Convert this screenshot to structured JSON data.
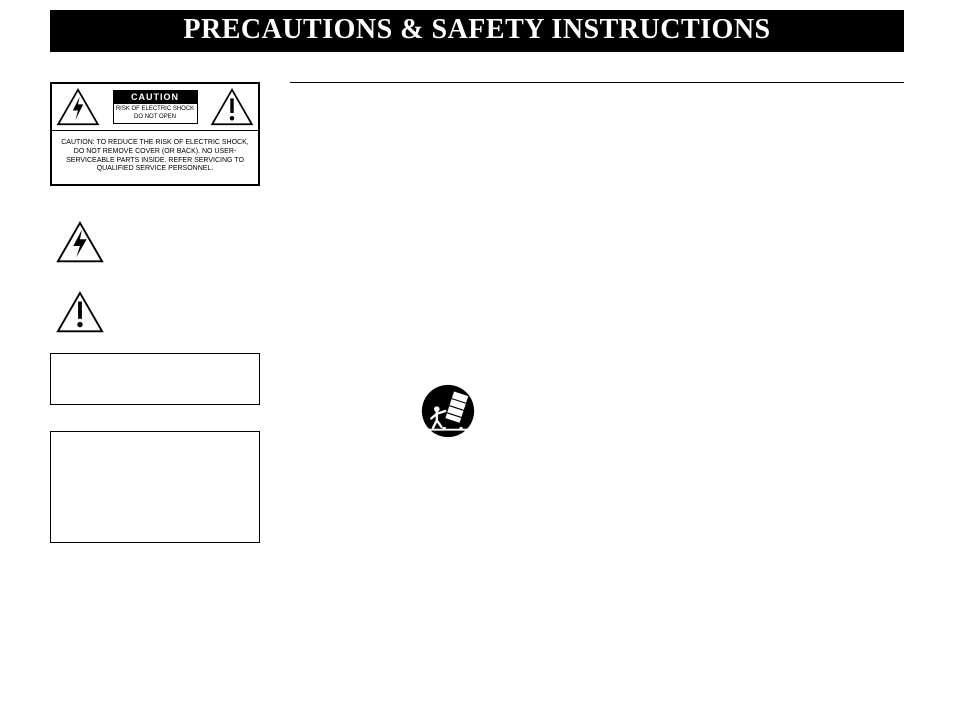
{
  "title": "PRECAUTIONS & SAFETY INSTRUCTIONS",
  "caution": {
    "header": "CAUTION",
    "sub1": "RISK OF ELECTRIC SHOCK",
    "sub2": "DO NOT OPEN",
    "body": "CAUTION:  TO REDUCE THE RISK OF ELECTRIC SHOCK, DO NOT REMOVE COVER (OR BACK). NO USER-SERVICEABLE PARTS INSIDE. REFER SERVICING TO QUALIFIED SERVICE PERSONNEL."
  }
}
